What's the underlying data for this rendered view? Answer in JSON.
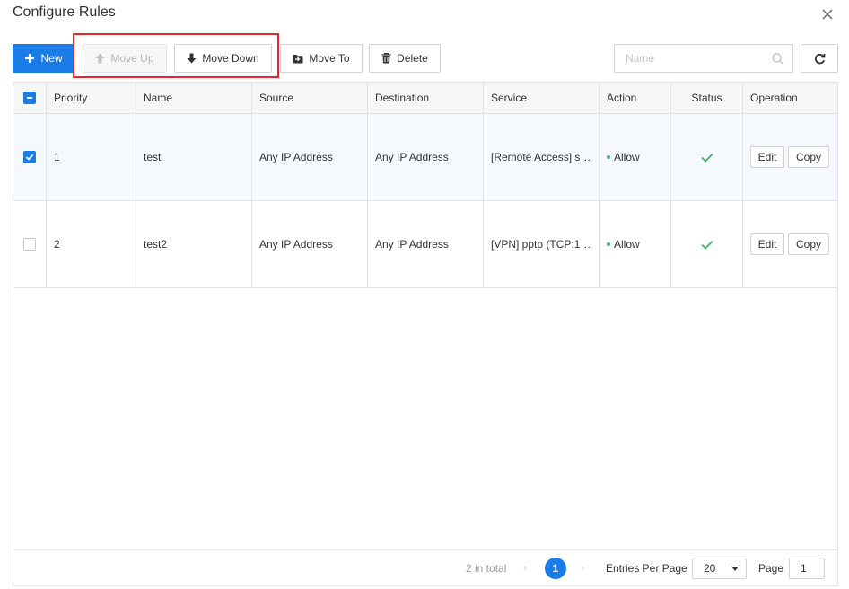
{
  "dialog": {
    "title": "Configure Rules"
  },
  "toolbar": {
    "new_label": "New",
    "move_up_label": "Move Up",
    "move_down_label": "Move Down",
    "move_to_label": "Move To",
    "delete_label": "Delete"
  },
  "search": {
    "placeholder": "Name",
    "value": ""
  },
  "table": {
    "columns": [
      "Priority",
      "Name",
      "Source",
      "Destination",
      "Service",
      "Action",
      "Status",
      "Operation"
    ],
    "rows": [
      {
        "checked": true,
        "priority": "1",
        "name": "test",
        "source": "Any IP Address",
        "destination": "Any IP Address",
        "service": "[Remote Access] s…",
        "action": "Allow",
        "status": "enabled",
        "edit": "Edit",
        "copy": "Copy"
      },
      {
        "checked": false,
        "priority": "2",
        "name": "test2",
        "source": "Any IP Address",
        "destination": "Any IP Address",
        "service": "[VPN] pptp (TCP:1…",
        "action": "Allow",
        "status": "enabled",
        "edit": "Edit",
        "copy": "Copy"
      }
    ]
  },
  "pagination": {
    "total_text": "2 in total",
    "current_page": "1",
    "entries_label": "Entries Per Page",
    "entries_value": "20",
    "page_label": "Page",
    "page_value": "1"
  },
  "colors": {
    "accent": "#1a7ce6",
    "highlight": "#e6272d",
    "allow": "#45b36b"
  },
  "icons": {
    "close": "close-icon",
    "new": "plus-icon",
    "move_up": "arrow-up-icon",
    "move_down": "arrow-down-icon",
    "move_to": "move-to-icon",
    "delete": "trash-icon",
    "search": "search-icon",
    "refresh": "refresh-icon",
    "status": "check-icon"
  }
}
